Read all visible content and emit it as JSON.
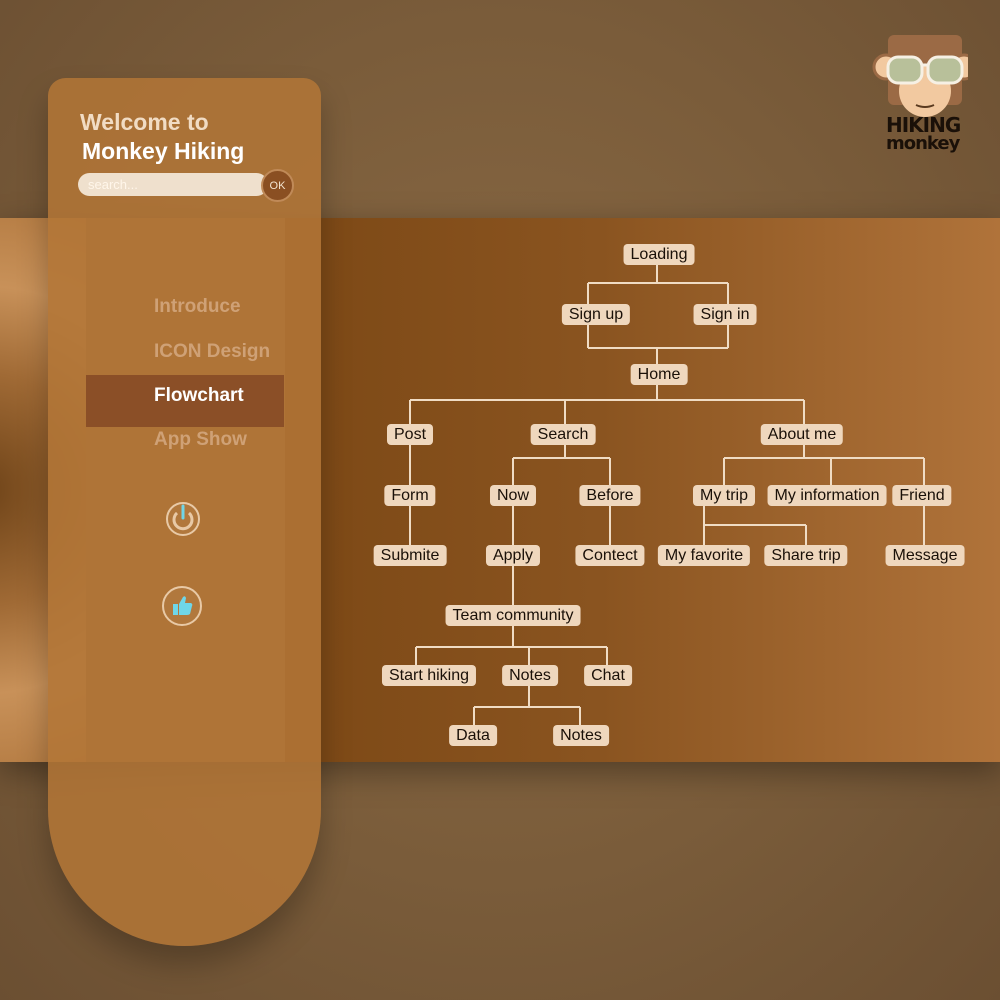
{
  "sidebar": {
    "welcome_line1": "Welcome to",
    "welcome_line2": "Monkey Hiking",
    "search_placeholder": "search...",
    "ok_label": "OK",
    "nav": [
      {
        "label": "Introduce",
        "active": false
      },
      {
        "label": "ICON Design",
        "active": false
      },
      {
        "label": "Flowchart",
        "active": true
      },
      {
        "label": "App Show",
        "active": false
      }
    ],
    "icons": [
      "power-icon",
      "thumbs-up-icon"
    ]
  },
  "logo": {
    "line1": "HIKING",
    "line2": "monkey"
  },
  "flowchart": {
    "loading": "Loading",
    "sign_up": "Sign up",
    "sign_in": "Sign in",
    "home": "Home",
    "post": "Post",
    "search": "Search",
    "about_me": "About me",
    "form": "Form",
    "now": "Now",
    "before": "Before",
    "my_trip": "My trip",
    "my_information": "My information",
    "friend": "Friend",
    "submite": "Submite",
    "apply": "Apply",
    "contect": "Contect",
    "my_favorite": "My favorite",
    "share_trip": "Share trip",
    "message": "Message",
    "team_community": "Team community",
    "start_hiking": "Start hiking",
    "notes": "Notes",
    "chat": "Chat",
    "data": "Data",
    "notes_sub": "Notes"
  },
  "colors": {
    "accent": "#8b4f27",
    "node_fill": "#efd7bd",
    "line": "#f0dcc4"
  }
}
